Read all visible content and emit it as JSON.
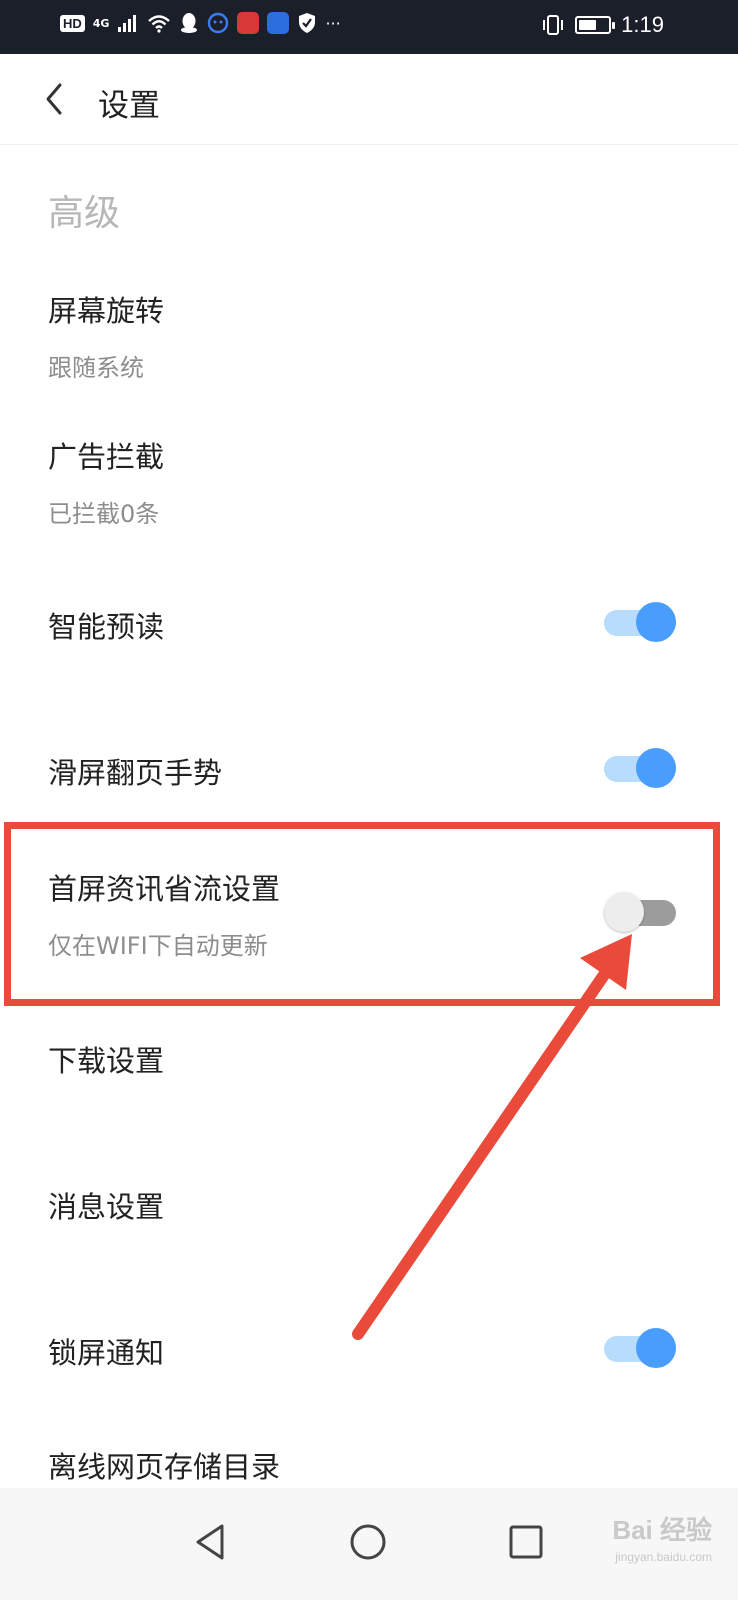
{
  "status_bar": {
    "time": "1:19",
    "hd_badge": "HD",
    "network": "4G",
    "overflow": "···",
    "battery_level": 0.6,
    "icons": [
      "hd-icon",
      "signal-icon",
      "wifi-icon",
      "qq-icon",
      "app-icon",
      "heart-app-icon",
      "bulb-app-icon",
      "shield-icon",
      "vibrate-icon",
      "battery-icon"
    ]
  },
  "header": {
    "title": "设置",
    "back_icon": "chevron-left-icon"
  },
  "section_title": "高级",
  "settings": [
    {
      "title": "屏幕旋转",
      "subtitle": "跟随系统"
    },
    {
      "title": "广告拦截",
      "subtitle": "已拦截0条"
    },
    {
      "title": "智能预读",
      "toggle": true
    },
    {
      "title": "滑屏翻页手势",
      "toggle": true
    },
    {
      "title": "首屏资讯省流设置",
      "subtitle": "仅在WIFI下自动更新",
      "toggle": false
    },
    {
      "title": "下载设置"
    },
    {
      "title": "消息设置"
    },
    {
      "title": "锁屏通知",
      "toggle": true
    },
    {
      "title": "离线网页存储目录"
    }
  ],
  "navbar": {
    "back": "triangle-back-icon",
    "home": "circle-home-icon",
    "recents": "square-recents-icon"
  },
  "watermark": {
    "text": "Bai 经验",
    "sub": "jingyan.baidu.com"
  },
  "colors": {
    "accent": "#4a9efb",
    "accent_light": "#b8dcfb",
    "annotation": "#e94a3a",
    "status_bar": "#1b1f2a"
  }
}
